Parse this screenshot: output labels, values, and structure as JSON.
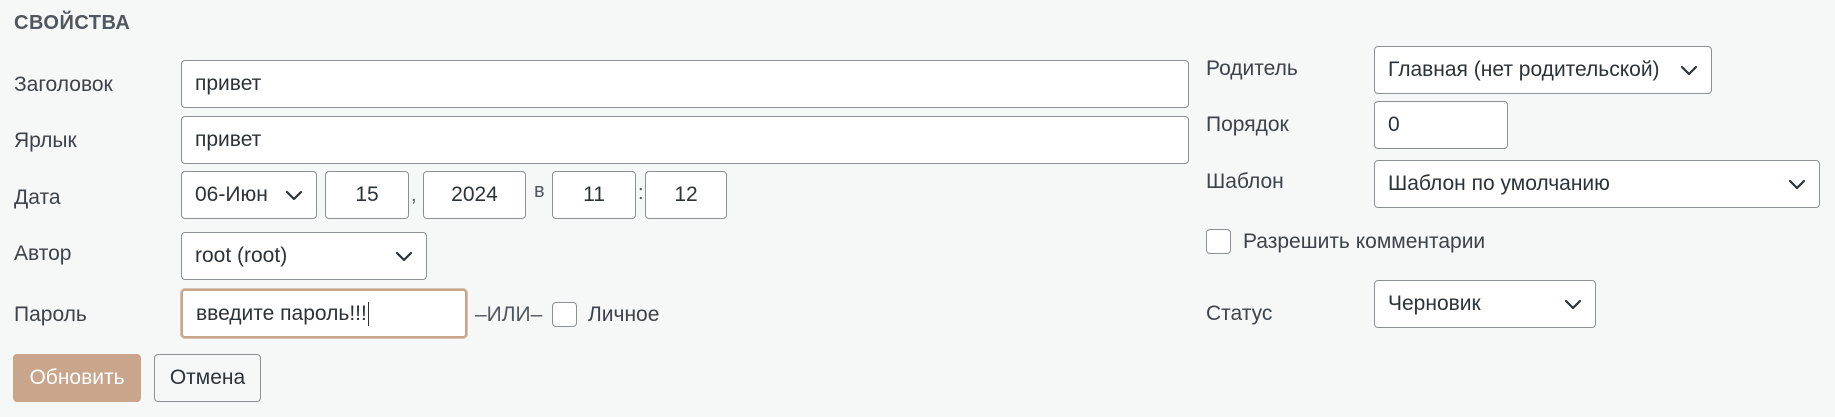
{
  "section": {
    "title": "СВОЙСТВА"
  },
  "left": {
    "title_label": "Заголовок",
    "title_value": "привет",
    "slug_label": "Ярлык",
    "slug_value": "привет",
    "date_label": "Дата",
    "date_month": "06-Июн",
    "date_day": "15",
    "date_comma": ",",
    "date_year": "2024",
    "date_at": "в",
    "date_hour": "11",
    "date_colon": ":",
    "date_minute": "12",
    "author_label": "Автор",
    "author_value": "root (root)",
    "password_label": "Пароль",
    "password_value": "введите пароль!!!",
    "or_text": "–ИЛИ–",
    "private_label": "Личное"
  },
  "right": {
    "parent_label": "Родитель",
    "parent_value": "Главная (нет родительской)",
    "order_label": "Порядок",
    "order_value": "0",
    "template_label": "Шаблон",
    "template_value": "Шаблон по умолчанию",
    "comments_label": "Разрешить комментарии",
    "status_label": "Статус",
    "status_value": "Черновик"
  },
  "buttons": {
    "update": "Обновить",
    "cancel": "Отмена"
  },
  "colors": {
    "background": "#f6f7f7",
    "primary_button": "#c8a58b",
    "focus_border": "#c8a58b",
    "border": "#8c8f94",
    "text": "#3c434a"
  },
  "icons": {
    "select_arrow": "chevron-down-icon"
  }
}
